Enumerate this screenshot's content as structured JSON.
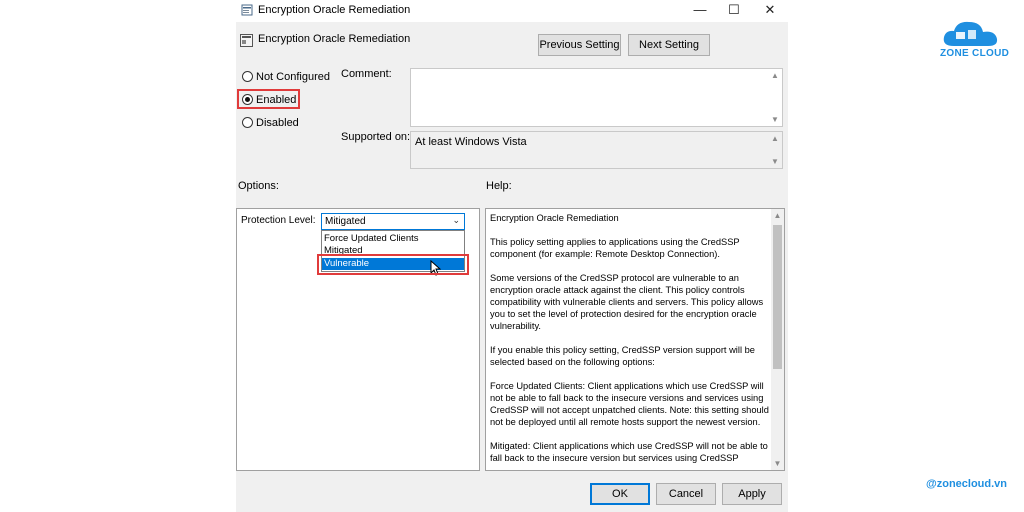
{
  "window": {
    "title": "Encryption Oracle Remediation",
    "minimize_glyph": "—",
    "maximize_glyph": "☐",
    "close_glyph": "✕"
  },
  "header": {
    "policy_name": "Encryption Oracle Remediation",
    "previous_label": "Previous Setting",
    "next_label": "Next Setting"
  },
  "state": {
    "options": [
      {
        "label": "Not Configured",
        "checked": false
      },
      {
        "label": "Enabled",
        "checked": true
      },
      {
        "label": "Disabled",
        "checked": false
      }
    ]
  },
  "comment": {
    "label": "Comment:",
    "value": ""
  },
  "supported": {
    "label": "Supported on:",
    "value": "At least Windows Vista"
  },
  "options_label": "Options:",
  "help_label": "Help:",
  "protection": {
    "label": "Protection Level:",
    "selected": "Mitigated",
    "items": [
      "Force Updated Clients",
      "Mitigated",
      "Vulnerable"
    ],
    "highlighted": "Vulnerable"
  },
  "help": {
    "title": "Encryption Oracle Remediation",
    "paragraphs": [
      "This policy setting applies to applications using the CredSSP component (for example: Remote Desktop Connection).",
      "Some versions of the CredSSP protocol are vulnerable to an encryption oracle attack against the client.  This policy controls compatibility with vulnerable clients and servers.  This policy allows you to set the level of protection desired for the encryption oracle vulnerability.",
      "If you enable this policy setting, CredSSP version support will be selected based on the following options:",
      "Force Updated Clients: Client applications which use CredSSP will not be able to fall back to the insecure versions and services using CredSSP will not accept unpatched clients. Note: this setting should not be deployed until all remote hosts support the newest version.",
      "Mitigated: Client applications which use CredSSP will not be able to fall back to the insecure version but services using CredSSP"
    ]
  },
  "footer": {
    "ok_label": "OK",
    "cancel_label": "Cancel",
    "apply_label": "Apply"
  },
  "brand": {
    "logo_text": "ZONE CLOUD",
    "site": "@zonecloud.vn",
    "color": "#1f8fe0"
  },
  "colors": {
    "accent": "#0078d7",
    "highlight_annotation": "#e03b3b",
    "selection": "#0078d7"
  }
}
